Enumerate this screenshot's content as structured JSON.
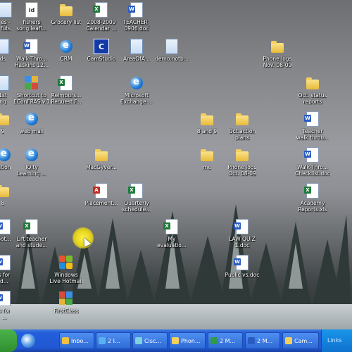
{
  "desktop": {
    "icons": [
      {
        "label": "es -\nfuts",
        "type": "txtdoc"
      },
      {
        "label": "fishers\nsong.leafl...",
        "type": "fishdoc",
        "glyph": "id"
      },
      {
        "label": "Grocery list",
        "type": "folder"
      },
      {
        "label": "2008-2009\nCalendar ...",
        "type": "xls"
      },
      {
        "label": "TEACHER_\n0906.doc",
        "type": "doc"
      },
      {
        "label": "ds",
        "type": "txtdoc"
      },
      {
        "label": "Walk-Thro...\nHaskins 12...",
        "type": "doc"
      },
      {
        "label": "CRM",
        "type": "globe"
      },
      {
        "label": "CamStudio",
        "type": "square",
        "glyph": "C"
      },
      {
        "label": "AreaOfA...",
        "type": "txtdoc"
      },
      {
        "label": "demo.notb...",
        "type": "txtdoc"
      },
      {
        "label": "Phone logs\nNov. 08-09",
        "type": "folder"
      },
      {
        "label": "1st\nng",
        "type": "txtdoc"
      },
      {
        "label": "Shortcut to\nEConFRAS v.1",
        "type": "multi"
      },
      {
        "label": "Reimburs...\nRequest F...",
        "type": "xls"
      },
      {
        "label": "Microsoft\nExchange ...",
        "type": "globe"
      },
      {
        "label": "Oct. status\nreports",
        "type": "folder"
      },
      {
        "label": "9",
        "type": "folder"
      },
      {
        "label": "web mail",
        "type": "globe"
      },
      {
        "label": "8 and 9",
        "type": "folder"
      },
      {
        "label": "Oct.action\nplans",
        "type": "folder"
      },
      {
        "label": "Teacher\nwalk throu...",
        "type": "doc"
      },
      {
        "label": "ation",
        "type": "globe"
      },
      {
        "label": "IQity\nLearning ...",
        "type": "globe"
      },
      {
        "label": "MacGyver...",
        "type": "folder"
      },
      {
        "label": "me",
        "type": "folder"
      },
      {
        "label": "Phone logs\nOct. 08-09",
        "type": "folder"
      },
      {
        "label": "Walk-Thro...\nChecklist.doc",
        "type": "doc"
      },
      {
        "label": "8",
        "type": "folder"
      },
      {
        "label": "Placement...",
        "type": "pdf"
      },
      {
        "label": "Quarterly\nschedule...",
        "type": "xls"
      },
      {
        "label": "Academy\nReports.xls",
        "type": "xls"
      },
      {
        "label": "oot...",
        "type": "doc"
      },
      {
        "label": "Lift teacher\nand stude...",
        "type": "xls"
      },
      {
        "label": "My\nevaluatio...",
        "type": "xls"
      },
      {
        "label": "LAW QUIZ\n1.doc",
        "type": "doc"
      },
      {
        "label": "s for\nd...",
        "type": "doc"
      },
      {
        "label": "Windows\nLive Hotmail",
        "type": "winflag"
      },
      {
        "label": "Public vs.doc",
        "type": "doc"
      },
      {
        "label": "s for\n...",
        "type": "doc"
      },
      {
        "label": "FirstClass",
        "type": "multi"
      }
    ]
  },
  "taskbar": {
    "buttons": [
      {
        "label": "Inbo..."
      },
      {
        "label": "2 I..."
      },
      {
        "label": "Cisc..."
      },
      {
        "label": "Phon..."
      },
      {
        "label": "2 M..."
      },
      {
        "label": "2 M..."
      },
      {
        "label": "Cam..."
      }
    ],
    "tray_label": "Links"
  },
  "colors": {
    "taskbar": "#245edb",
    "start": "#2f8f2f",
    "cursor_highlight": "#e4d21a"
  }
}
